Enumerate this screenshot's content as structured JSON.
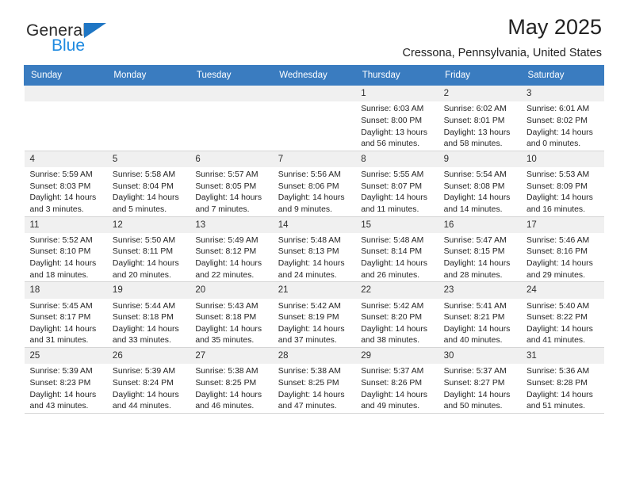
{
  "brand": {
    "name_top": "General",
    "name_bottom": "Blue",
    "triangle_color": "#1f76c4"
  },
  "header": {
    "month_title": "May 2025",
    "location": "Cressona, Pennsylvania, United States",
    "accent_color": "#3a7cc0"
  },
  "calendar": {
    "weekday_headers": [
      "Sunday",
      "Monday",
      "Tuesday",
      "Wednesday",
      "Thursday",
      "Friday",
      "Saturday"
    ],
    "weeks": [
      [
        {
          "day": "",
          "blank": true,
          "sunrise": "",
          "sunset": "",
          "daylight1": "",
          "daylight2": ""
        },
        {
          "day": "",
          "blank": true,
          "sunrise": "",
          "sunset": "",
          "daylight1": "",
          "daylight2": ""
        },
        {
          "day": "",
          "blank": true,
          "sunrise": "",
          "sunset": "",
          "daylight1": "",
          "daylight2": ""
        },
        {
          "day": "",
          "blank": true,
          "sunrise": "",
          "sunset": "",
          "daylight1": "",
          "daylight2": ""
        },
        {
          "day": "1",
          "sunrise": "Sunrise: 6:03 AM",
          "sunset": "Sunset: 8:00 PM",
          "daylight1": "Daylight: 13 hours",
          "daylight2": "and 56 minutes."
        },
        {
          "day": "2",
          "sunrise": "Sunrise: 6:02 AM",
          "sunset": "Sunset: 8:01 PM",
          "daylight1": "Daylight: 13 hours",
          "daylight2": "and 58 minutes."
        },
        {
          "day": "3",
          "sunrise": "Sunrise: 6:01 AM",
          "sunset": "Sunset: 8:02 PM",
          "daylight1": "Daylight: 14 hours",
          "daylight2": "and 0 minutes."
        }
      ],
      [
        {
          "day": "4",
          "sunrise": "Sunrise: 5:59 AM",
          "sunset": "Sunset: 8:03 PM",
          "daylight1": "Daylight: 14 hours",
          "daylight2": "and 3 minutes."
        },
        {
          "day": "5",
          "sunrise": "Sunrise: 5:58 AM",
          "sunset": "Sunset: 8:04 PM",
          "daylight1": "Daylight: 14 hours",
          "daylight2": "and 5 minutes."
        },
        {
          "day": "6",
          "sunrise": "Sunrise: 5:57 AM",
          "sunset": "Sunset: 8:05 PM",
          "daylight1": "Daylight: 14 hours",
          "daylight2": "and 7 minutes."
        },
        {
          "day": "7",
          "sunrise": "Sunrise: 5:56 AM",
          "sunset": "Sunset: 8:06 PM",
          "daylight1": "Daylight: 14 hours",
          "daylight2": "and 9 minutes."
        },
        {
          "day": "8",
          "sunrise": "Sunrise: 5:55 AM",
          "sunset": "Sunset: 8:07 PM",
          "daylight1": "Daylight: 14 hours",
          "daylight2": "and 11 minutes."
        },
        {
          "day": "9",
          "sunrise": "Sunrise: 5:54 AM",
          "sunset": "Sunset: 8:08 PM",
          "daylight1": "Daylight: 14 hours",
          "daylight2": "and 14 minutes."
        },
        {
          "day": "10",
          "sunrise": "Sunrise: 5:53 AM",
          "sunset": "Sunset: 8:09 PM",
          "daylight1": "Daylight: 14 hours",
          "daylight2": "and 16 minutes."
        }
      ],
      [
        {
          "day": "11",
          "sunrise": "Sunrise: 5:52 AM",
          "sunset": "Sunset: 8:10 PM",
          "daylight1": "Daylight: 14 hours",
          "daylight2": "and 18 minutes."
        },
        {
          "day": "12",
          "sunrise": "Sunrise: 5:50 AM",
          "sunset": "Sunset: 8:11 PM",
          "daylight1": "Daylight: 14 hours",
          "daylight2": "and 20 minutes."
        },
        {
          "day": "13",
          "sunrise": "Sunrise: 5:49 AM",
          "sunset": "Sunset: 8:12 PM",
          "daylight1": "Daylight: 14 hours",
          "daylight2": "and 22 minutes."
        },
        {
          "day": "14",
          "sunrise": "Sunrise: 5:48 AM",
          "sunset": "Sunset: 8:13 PM",
          "daylight1": "Daylight: 14 hours",
          "daylight2": "and 24 minutes."
        },
        {
          "day": "15",
          "sunrise": "Sunrise: 5:48 AM",
          "sunset": "Sunset: 8:14 PM",
          "daylight1": "Daylight: 14 hours",
          "daylight2": "and 26 minutes."
        },
        {
          "day": "16",
          "sunrise": "Sunrise: 5:47 AM",
          "sunset": "Sunset: 8:15 PM",
          "daylight1": "Daylight: 14 hours",
          "daylight2": "and 28 minutes."
        },
        {
          "day": "17",
          "sunrise": "Sunrise: 5:46 AM",
          "sunset": "Sunset: 8:16 PM",
          "daylight1": "Daylight: 14 hours",
          "daylight2": "and 29 minutes."
        }
      ],
      [
        {
          "day": "18",
          "sunrise": "Sunrise: 5:45 AM",
          "sunset": "Sunset: 8:17 PM",
          "daylight1": "Daylight: 14 hours",
          "daylight2": "and 31 minutes."
        },
        {
          "day": "19",
          "sunrise": "Sunrise: 5:44 AM",
          "sunset": "Sunset: 8:18 PM",
          "daylight1": "Daylight: 14 hours",
          "daylight2": "and 33 minutes."
        },
        {
          "day": "20",
          "sunrise": "Sunrise: 5:43 AM",
          "sunset": "Sunset: 8:18 PM",
          "daylight1": "Daylight: 14 hours",
          "daylight2": "and 35 minutes."
        },
        {
          "day": "21",
          "sunrise": "Sunrise: 5:42 AM",
          "sunset": "Sunset: 8:19 PM",
          "daylight1": "Daylight: 14 hours",
          "daylight2": "and 37 minutes."
        },
        {
          "day": "22",
          "sunrise": "Sunrise: 5:42 AM",
          "sunset": "Sunset: 8:20 PM",
          "daylight1": "Daylight: 14 hours",
          "daylight2": "and 38 minutes."
        },
        {
          "day": "23",
          "sunrise": "Sunrise: 5:41 AM",
          "sunset": "Sunset: 8:21 PM",
          "daylight1": "Daylight: 14 hours",
          "daylight2": "and 40 minutes."
        },
        {
          "day": "24",
          "sunrise": "Sunrise: 5:40 AM",
          "sunset": "Sunset: 8:22 PM",
          "daylight1": "Daylight: 14 hours",
          "daylight2": "and 41 minutes."
        }
      ],
      [
        {
          "day": "25",
          "sunrise": "Sunrise: 5:39 AM",
          "sunset": "Sunset: 8:23 PM",
          "daylight1": "Daylight: 14 hours",
          "daylight2": "and 43 minutes."
        },
        {
          "day": "26",
          "sunrise": "Sunrise: 5:39 AM",
          "sunset": "Sunset: 8:24 PM",
          "daylight1": "Daylight: 14 hours",
          "daylight2": "and 44 minutes."
        },
        {
          "day": "27",
          "sunrise": "Sunrise: 5:38 AM",
          "sunset": "Sunset: 8:25 PM",
          "daylight1": "Daylight: 14 hours",
          "daylight2": "and 46 minutes."
        },
        {
          "day": "28",
          "sunrise": "Sunrise: 5:38 AM",
          "sunset": "Sunset: 8:25 PM",
          "daylight1": "Daylight: 14 hours",
          "daylight2": "and 47 minutes."
        },
        {
          "day": "29",
          "sunrise": "Sunrise: 5:37 AM",
          "sunset": "Sunset: 8:26 PM",
          "daylight1": "Daylight: 14 hours",
          "daylight2": "and 49 minutes."
        },
        {
          "day": "30",
          "sunrise": "Sunrise: 5:37 AM",
          "sunset": "Sunset: 8:27 PM",
          "daylight1": "Daylight: 14 hours",
          "daylight2": "and 50 minutes."
        },
        {
          "day": "31",
          "sunrise": "Sunrise: 5:36 AM",
          "sunset": "Sunset: 8:28 PM",
          "daylight1": "Daylight: 14 hours",
          "daylight2": "and 51 minutes."
        }
      ]
    ]
  }
}
